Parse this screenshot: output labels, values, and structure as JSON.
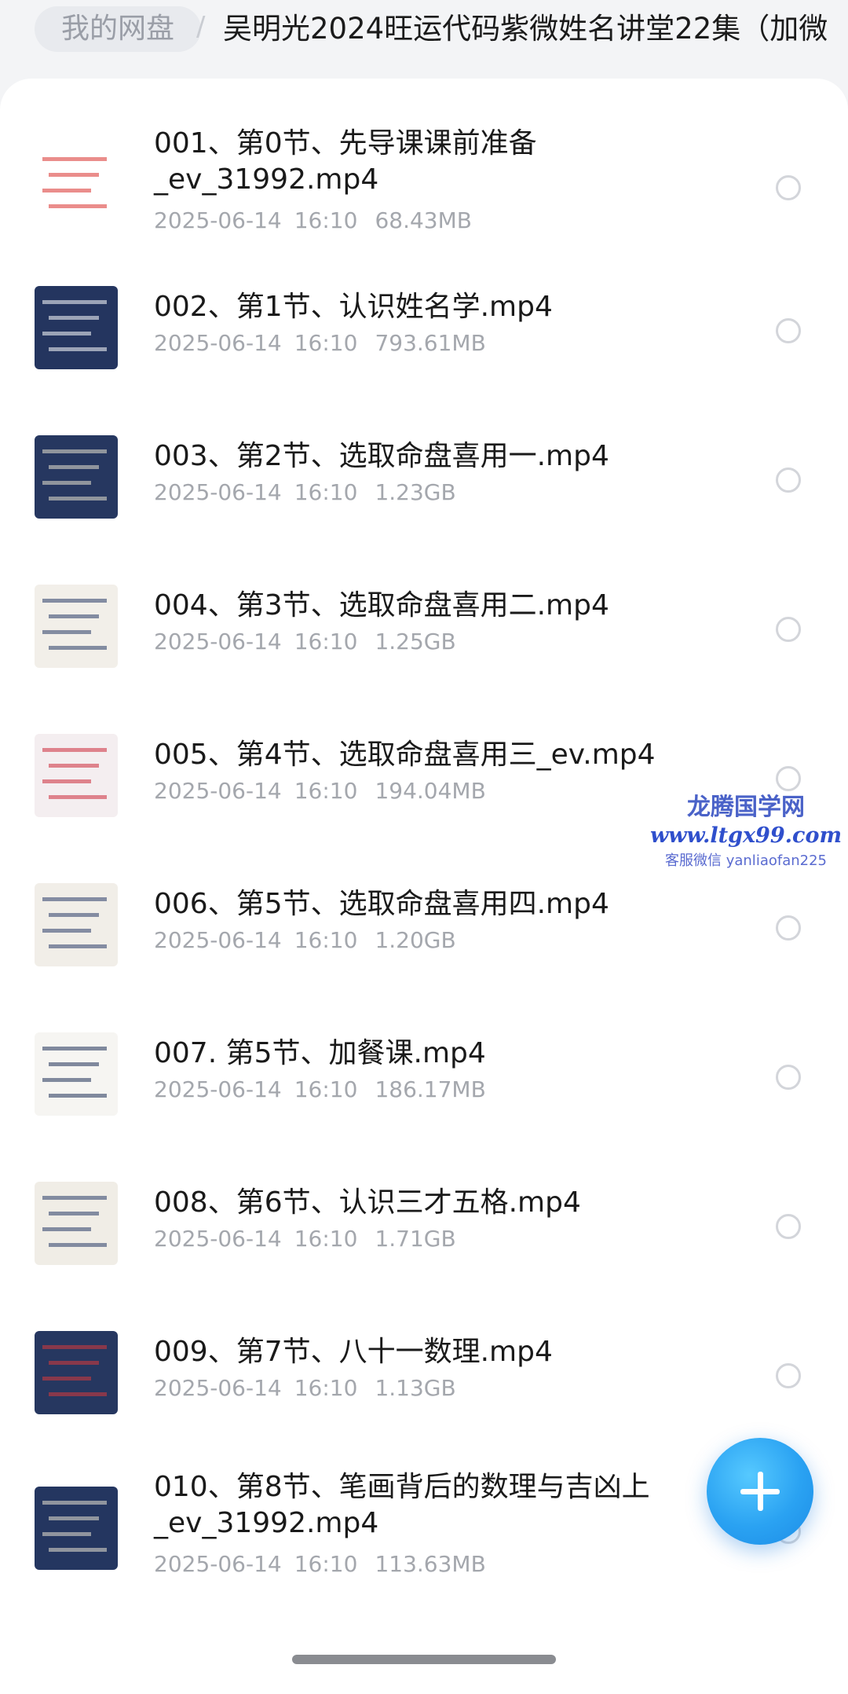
{
  "breadcrumb": {
    "root": "我的网盘",
    "separator": "/",
    "current": "吴明光2024旺运代码紫微姓名讲堂22集（加微"
  },
  "files": [
    {
      "name": "001、第0节、先导课课前准备_ev_31992.mp4",
      "date": "2025-06-14",
      "time": "16:10",
      "size": "68.43MB",
      "thumb_bg": "#ffffff",
      "thumb_accent": "#d9302c"
    },
    {
      "name": "002、第1节、认识姓名学.mp4",
      "date": "2025-06-14",
      "time": "16:10",
      "size": "793.61MB",
      "thumb_bg": "#24355f",
      "thumb_accent": "#ffffff"
    },
    {
      "name": "003、第2节、选取命盘喜用一.mp4",
      "date": "2025-06-14",
      "time": "16:10",
      "size": "1.23GB",
      "thumb_bg": "#263760",
      "thumb_accent": "#e8e3d0"
    },
    {
      "name": "004、第3节、选取命盘喜用二.mp4",
      "date": "2025-06-14",
      "time": "16:10",
      "size": "1.25GB",
      "thumb_bg": "#f2efe9",
      "thumb_accent": "#283a66"
    },
    {
      "name": "005、第4节、选取命盘喜用三_ev.mp4",
      "date": "2025-06-14",
      "time": "16:10",
      "size": "194.04MB",
      "thumb_bg": "#f4eef0",
      "thumb_accent": "#cc2a3a"
    },
    {
      "name": "006、第5节、选取命盘喜用四.mp4",
      "date": "2025-06-14",
      "time": "16:10",
      "size": "1.20GB",
      "thumb_bg": "#f1eee8",
      "thumb_accent": "#2a3c68"
    },
    {
      "name": "007. 第5节、加餐课.mp4",
      "date": "2025-06-14",
      "time": "16:10",
      "size": "186.17MB",
      "thumb_bg": "#f6f5f2",
      "thumb_accent": "#1f2f58"
    },
    {
      "name": "008、第6节、认识三才五格.mp4",
      "date": "2025-06-14",
      "time": "16:10",
      "size": "1.71GB",
      "thumb_bg": "#f0ede6",
      "thumb_accent": "#283a66"
    },
    {
      "name": "009、第7节、八十一数理.mp4",
      "date": "2025-06-14",
      "time": "16:10",
      "size": "1.13GB",
      "thumb_bg": "#263760",
      "thumb_accent": "#d93a3a"
    },
    {
      "name": "010、第8节、笔画背后的数理与吉凶上_ev_31992.mp4",
      "date": "2025-06-14",
      "time": "16:10",
      "size": "113.63MB",
      "thumb_bg": "#243660",
      "thumb_accent": "#e9e4d2"
    }
  ],
  "watermark": {
    "title": "龙腾国学网",
    "url": "www.ltgx99.com",
    "contact": "客服微信 yanliaofan225"
  },
  "fab": {
    "icon": "plus-icon",
    "color": "#2aa2f2"
  }
}
